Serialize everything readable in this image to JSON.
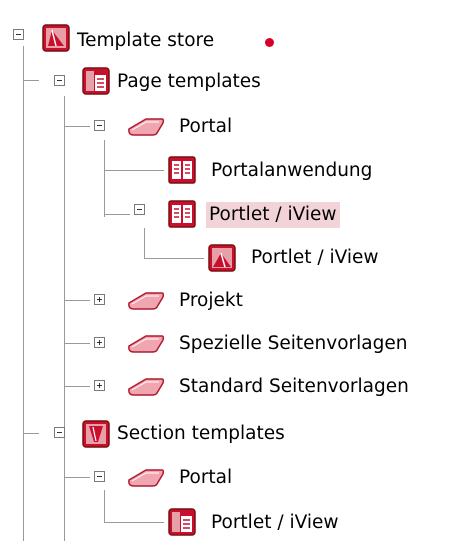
{
  "tree": {
    "root": {
      "label": "Template store",
      "icon": "template-store-icon",
      "status_dot_color": "#d6002a",
      "expanded": true
    },
    "page_templates": {
      "label": "Page templates",
      "icon": "page-template-folder-icon",
      "expanded": true
    },
    "page_portal": {
      "label": "Portal",
      "icon": "category-tag-icon",
      "expanded": true
    },
    "portalanwendung": {
      "label": "Portalanwendung",
      "icon": "page-template-icon"
    },
    "portlet_page": {
      "label": "Portlet / iView",
      "icon": "page-template-icon",
      "expanded": true,
      "selected": true
    },
    "portlet_section_child": {
      "label": "Portlet / iView",
      "icon": "section-template-icon"
    },
    "projekt": {
      "label": "Projekt",
      "icon": "category-tag-icon",
      "expanded": false
    },
    "spezielle": {
      "label": "Spezielle Seitenvorlagen",
      "icon": "category-tag-icon",
      "expanded": false
    },
    "standard": {
      "label": "Standard Seitenvorlagen",
      "icon": "category-tag-icon",
      "expanded": false
    },
    "section_templates": {
      "label": "Section templates",
      "icon": "section-template-folder-icon",
      "expanded": true
    },
    "section_portal": {
      "label": "Portal",
      "icon": "category-tag-icon",
      "expanded": true
    },
    "section_portlet": {
      "label": "Portlet / iView",
      "icon": "page-template-icon"
    }
  },
  "colors": {
    "icon_red": "#c8102e",
    "icon_border": "#8a1a1a",
    "selection": "#f2d4d8",
    "tree_lines": "#9a9a9a"
  }
}
